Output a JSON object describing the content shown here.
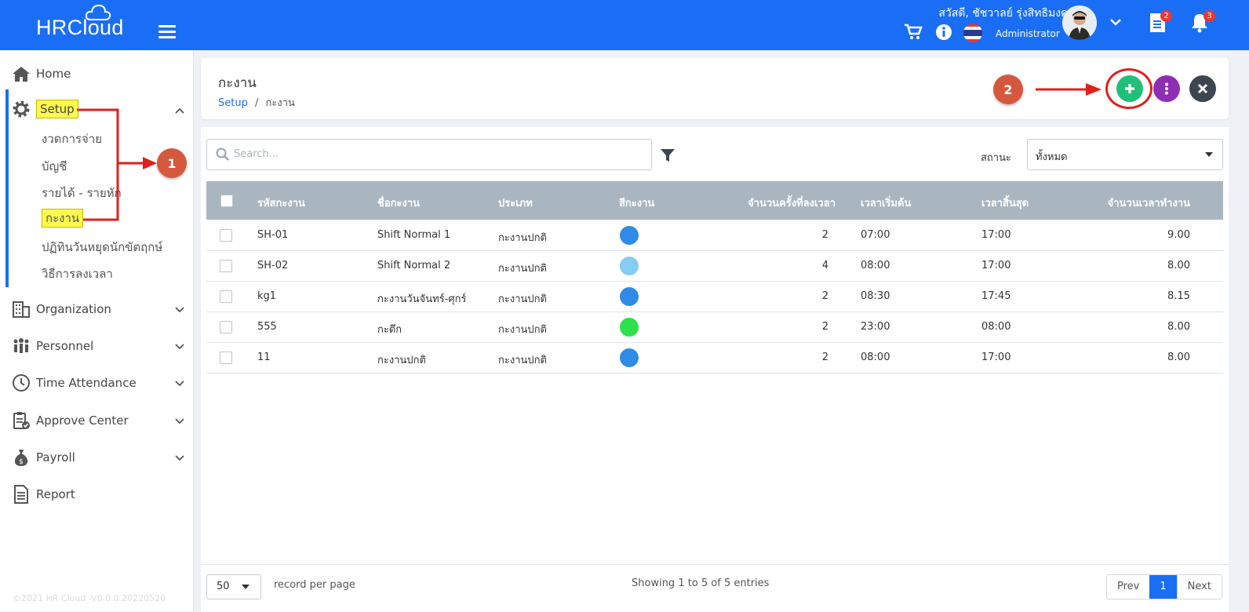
{
  "app": {
    "logo": "HRCloud"
  },
  "topbar": {
    "greeting": "สวัสดี, ชัชวาลย์ รุ่งสิทธิมงคล",
    "role": "Administrator",
    "badges": {
      "documents": "2",
      "notifications": "3"
    },
    "colors": {
      "bar": "#1a6ef5",
      "badge": "#e53935"
    }
  },
  "sidebar": {
    "items": [
      {
        "label": "Home",
        "icon": "home-icon"
      },
      {
        "label": "Setup",
        "icon": "gear-icon"
      },
      {
        "label": "Organization",
        "icon": "building-icon"
      },
      {
        "label": "Personnel",
        "icon": "people-icon"
      },
      {
        "label": "Time Attendance",
        "icon": "clock-icon"
      },
      {
        "label": "Approve Center",
        "icon": "clipboard-check-icon"
      },
      {
        "label": "Payroll",
        "icon": "money-bag-icon"
      },
      {
        "label": "Report",
        "icon": "document-icon"
      }
    ],
    "setup_sub": [
      "งวดการจ่าย",
      "บัญชี",
      "รายได้ - รายหัก",
      "กะงาน",
      "ปฏิทินวันหยุดนักขัตฤกษ์",
      "วิธีการลงเวลา"
    ],
    "footer": "©2021 HR Cloud -V0.0.0.20220520"
  },
  "header": {
    "title": "กะงาน",
    "breadcrumb_root": "Setup",
    "breadcrumb_sep": "/",
    "breadcrumb_current": "กะงาน",
    "button_colors": {
      "add": "#20c07a",
      "more": "#8e2db5",
      "close": "#3d4650"
    }
  },
  "annotations": {
    "step1": "1",
    "step2": "2",
    "color": "#d4583e"
  },
  "toolbar": {
    "search_placeholder": "Search...",
    "status_label": "สถานะ",
    "status_value": "ทั้งหมด"
  },
  "table": {
    "columns": [
      "รหัสกะงาน",
      "ชื่อกะงาน",
      "ประเภท",
      "สีกะงาน",
      "จำนวนครั้งที่ลงเวลา",
      "เวลาเริ่มต้น",
      "เวลาสิ้นสุด",
      "จำนวนเวลาทำงาน"
    ],
    "rows": [
      {
        "code": "SH-01",
        "name": "Shift Normal 1",
        "type": "กะงานปกติ",
        "color": "#2f8be6",
        "punches": "2",
        "start": "07:00",
        "end": "17:00",
        "hours": "9.00"
      },
      {
        "code": "SH-02",
        "name": "Shift Normal 2",
        "type": "กะงานปกติ",
        "color": "#85cdf2",
        "punches": "4",
        "start": "08:00",
        "end": "17:00",
        "hours": "8.00"
      },
      {
        "code": "kg1",
        "name": "กะงานวันจันทร์-ศุกร์",
        "type": "กะงานปกติ",
        "color": "#2f8be6",
        "punches": "2",
        "start": "08:30",
        "end": "17:45",
        "hours": "8.15"
      },
      {
        "code": "555",
        "name": "กะดึก",
        "type": "กะงานปกติ",
        "color": "#2ee04c",
        "punches": "2",
        "start": "23:00",
        "end": "08:00",
        "hours": "8.00"
      },
      {
        "code": "11",
        "name": "กะงานปกติ",
        "type": "กะงานปกติ",
        "color": "#2f8be6",
        "punches": "2",
        "start": "08:00",
        "end": "17:00",
        "hours": "8.00"
      }
    ]
  },
  "footer": {
    "page_size": "50",
    "per_page_label": "record per page",
    "showing": "Showing 1 to 5 of 5 entries",
    "prev": "Prev",
    "page": "1",
    "next": "Next"
  }
}
